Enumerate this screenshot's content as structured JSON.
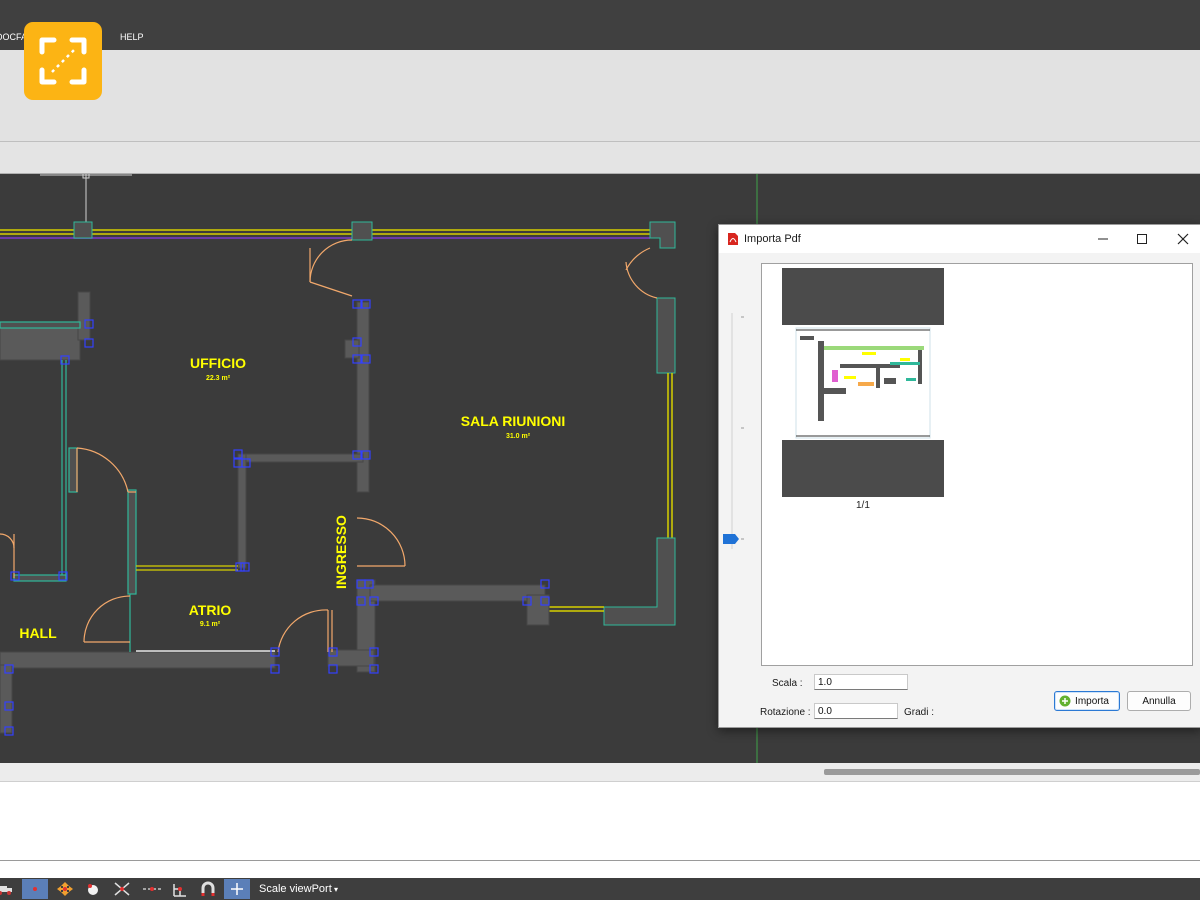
{
  "menubar": {
    "items": [
      {
        "label": "DOCFA"
      },
      {
        "label": "HELP"
      }
    ]
  },
  "app": {
    "logo_icon": "expand-arrows-logo-icon",
    "accent": "#fcb414"
  },
  "canvas": {
    "rooms": [
      {
        "name": "UFFICIO",
        "area": "22.3 m²"
      },
      {
        "name": "SALA RIUNIONI",
        "area": "31.0 m²"
      },
      {
        "name": "ATRIO",
        "area": "9.1 m²"
      },
      {
        "name": "HALL"
      },
      {
        "name": "INGRESSO"
      }
    ],
    "colors": {
      "background": "#3b3b3b",
      "room_label": "#ffff00",
      "wall_outline": "#2fb89a",
      "door": "#f2a86b",
      "grip": "#3340ff",
      "glass": "#ffff00"
    }
  },
  "statusbar": {
    "scale_viewport": "Scale viewPort",
    "icons": [
      "truck-icon",
      "point-snap-icon",
      "move-icon",
      "zoom-icon",
      "intersection-snap-icon",
      "midpoint-snap-icon",
      "perpendicular-snap-icon",
      "magnet-icon",
      "crosshair-icon"
    ]
  },
  "dialog": {
    "title": "Importa Pdf",
    "title_icon": "pdf-icon",
    "page_indicator": "1/1",
    "scale_label": "Scala :",
    "scale_value": "1.0",
    "rotation_label": "Rotazione :",
    "rotation_value": "0.0",
    "degrees_label": "Gradi :",
    "import_button": "Importa",
    "cancel_button": "Annulla"
  }
}
